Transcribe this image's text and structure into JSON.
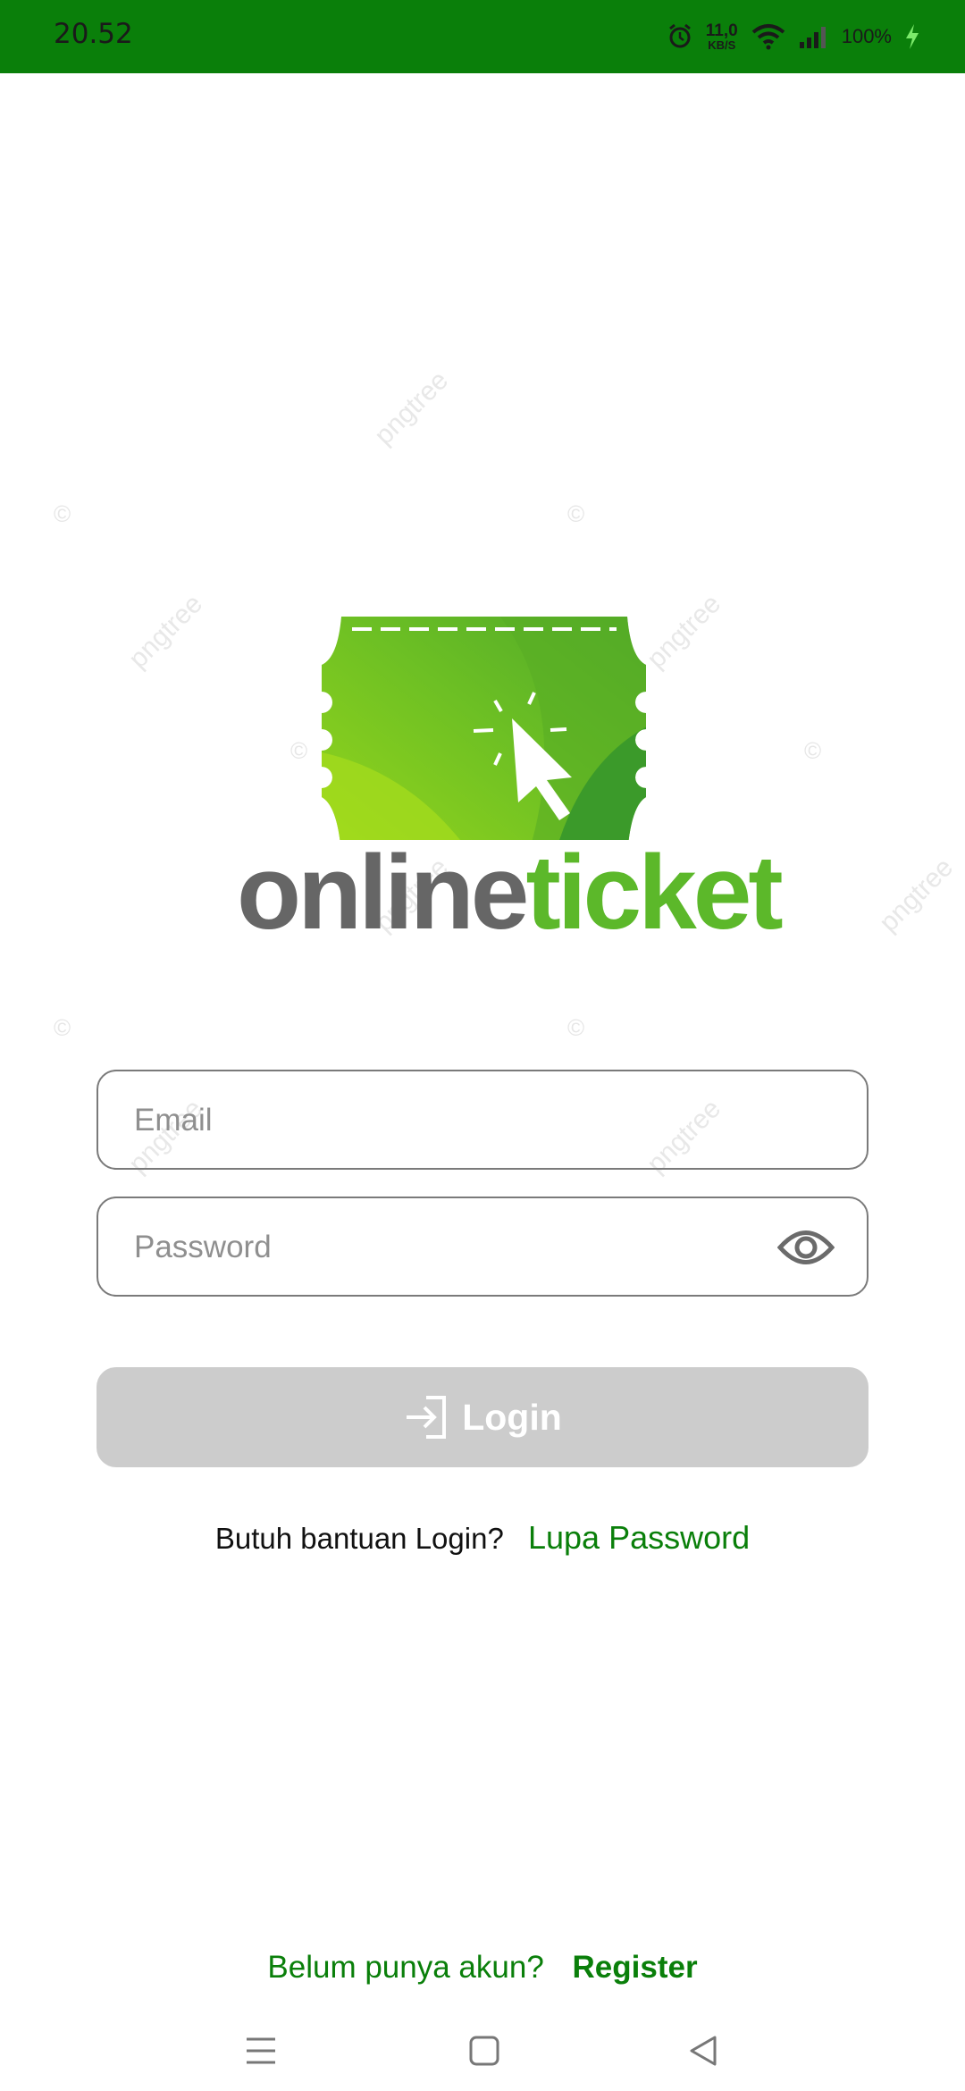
{
  "status_bar": {
    "time": "20.52",
    "net_speed_value": "11,0",
    "net_speed_unit": "KB/S",
    "battery": "100%",
    "icons": [
      "alarm-icon",
      "wifi-icon",
      "signal-icon",
      "charging-icon"
    ]
  },
  "watermark": {
    "text": "pngtree",
    "symbol": "©"
  },
  "logo": {
    "word_dark": "online",
    "word_green": "ticket",
    "colors": {
      "dark": "#666666",
      "green": "#5cb82a"
    }
  },
  "form": {
    "email_placeholder": "Email",
    "email_value": "",
    "password_placeholder": "Password",
    "password_value": "",
    "login_label": "Login"
  },
  "help": {
    "prompt": "Butuh bantuan Login?",
    "link": "Lupa Password"
  },
  "register": {
    "prompt": "Belum punya akun?",
    "link": "Register"
  },
  "nav": {
    "icons": [
      "menu-icon",
      "home-square-icon",
      "back-triangle-icon"
    ]
  },
  "colors": {
    "primary": "#0a7f0a",
    "button_disabled": "#cccccc",
    "border": "#7a7a7a"
  }
}
